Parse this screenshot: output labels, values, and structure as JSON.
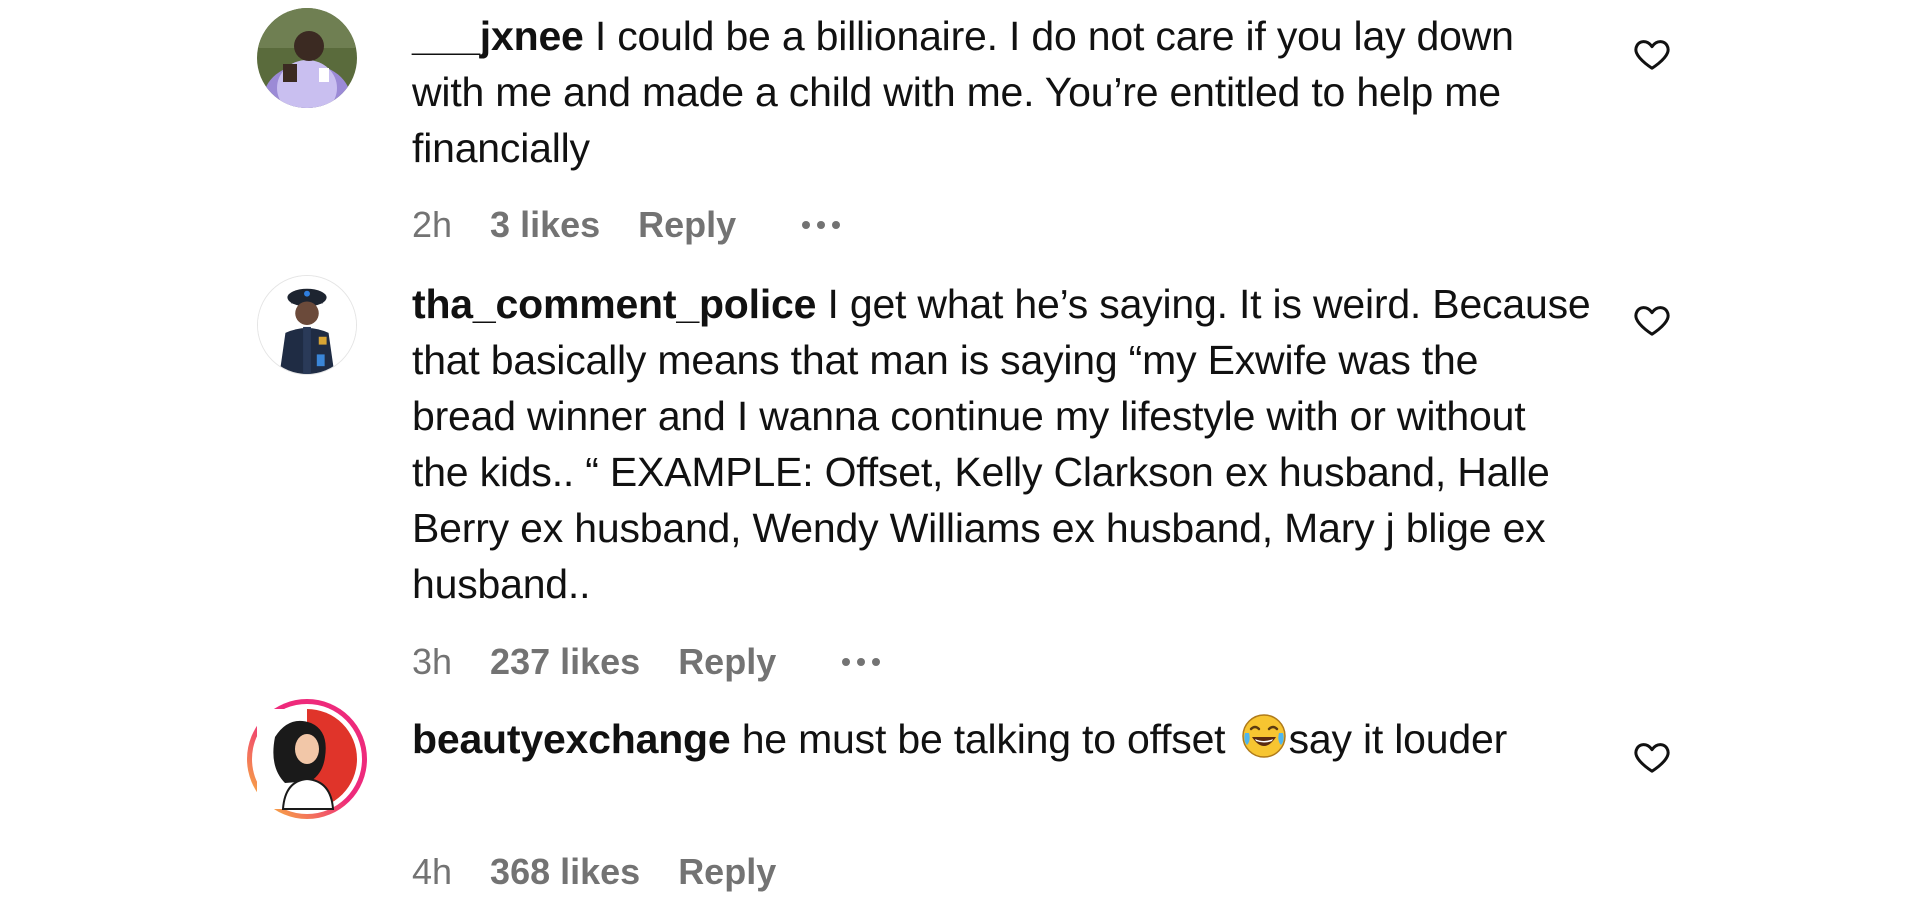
{
  "comments": [
    {
      "username": "___jxnee",
      "text": "I could be a billionaire. I do not care if you lay down with me and made a child with me. You’re entitled to help me financially",
      "time": "2h",
      "likes": "3 likes",
      "reply_label": "Reply",
      "avatar_icon": "avatar-photo-man-purple-shirt"
    },
    {
      "username": "tha_comment_police",
      "text": "I get what he’s saying. It is weird. Because that basically means that man is saying “my Exwife was the bread winner and I wanna continue my lifestyle with or without the kids.. “ EXAMPLE: Offset, Kelly Clarkson ex husband, Halle Berry ex husband, Wendy Williams ex husband, Mary j blige ex husband..",
      "time": "3h",
      "likes": "237 likes",
      "reply_label": "Reply",
      "avatar_icon": "avatar-police-officer-cartoon"
    },
    {
      "username": "beautyexchange",
      "text_before_emoji": "he must be talking to offset",
      "emoji_icon": "face-with-tears-of-joy-emoji",
      "text_after_emoji": "say it louder",
      "time": "4h",
      "likes": "368 likes",
      "reply_label": "Reply",
      "avatar_icon": "avatar-woman-illustration-story-ring"
    }
  ],
  "colors": {
    "text": "#111111",
    "meta": "#737373",
    "story_ring_start": "#f9ce34",
    "story_ring_end": "#ee2a7b"
  }
}
